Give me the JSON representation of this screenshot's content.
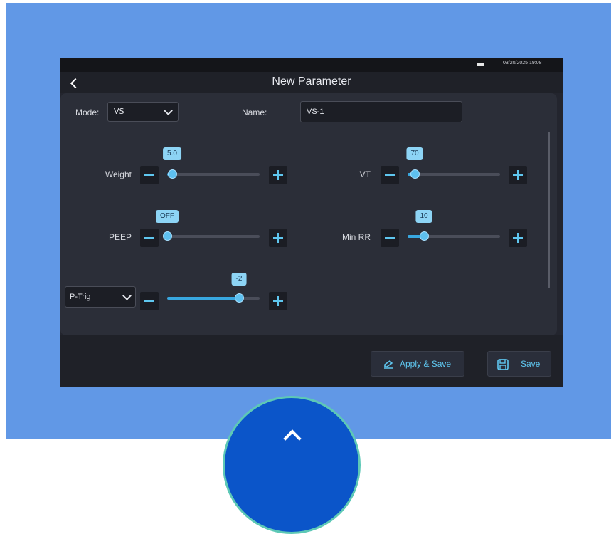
{
  "status": {
    "datetime": "03/20/2025 19:08"
  },
  "header": {
    "title": "New Parameter"
  },
  "form": {
    "mode_label": "Mode:",
    "mode_value": "VS",
    "name_label": "Name:",
    "name_value": "VS-1"
  },
  "controls": {
    "weight": {
      "label": "Weight",
      "value": "5.0",
      "level": 0.05
    },
    "vt": {
      "label": "VT",
      "value": "70",
      "level": 0.08
    },
    "peep": {
      "label": "PEEP",
      "value": "OFF",
      "level": 0.0
    },
    "min_rr": {
      "label": "Min RR",
      "value": "10",
      "level": 0.18
    },
    "trigger": {
      "select_value": "P-Trig",
      "value": "-2",
      "level": 0.78
    }
  },
  "footer": {
    "apply_save_label": "Apply & Save",
    "save_label": "Save"
  },
  "colors": {
    "background": "#6198e6",
    "screen": "#23252e",
    "accent": "#5fc7f0",
    "bubble": "#8dd4f5"
  },
  "icons": [
    "back-chevron-icon",
    "battery-icon",
    "chevron-down-icon",
    "minus-icon",
    "plus-icon",
    "apply-save-icon",
    "save-icon",
    "arrow-up-icon"
  ]
}
